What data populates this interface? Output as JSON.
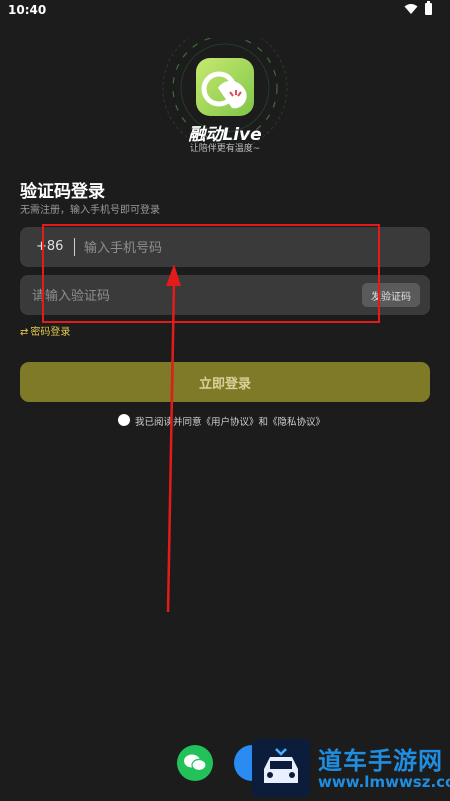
{
  "status_bar": {
    "time": "10:40"
  },
  "app": {
    "name": "融动Live",
    "slogan": "让陪伴更有温度~"
  },
  "login": {
    "title": "验证码登录",
    "subtitle": "无需注册，输入手机号即可登录",
    "country_code": "+86",
    "phone_placeholder": "输入手机号码",
    "code_placeholder": "请输入验证码",
    "send_code_label": "发验证码",
    "password_login_label": "密码登录",
    "submit_label": "立即登录",
    "agreement_text": "我已阅读并同意《用户协议》和《隐私协议》"
  },
  "watermark": {
    "title": "道车手游网",
    "url": "www.lmwwsz.com"
  },
  "colors": {
    "background": "#1c1c1c",
    "field": "#3a3a3a",
    "accent_button": "#7f7a27",
    "link": "#e3c84b",
    "annotation": "#e41b1b"
  }
}
